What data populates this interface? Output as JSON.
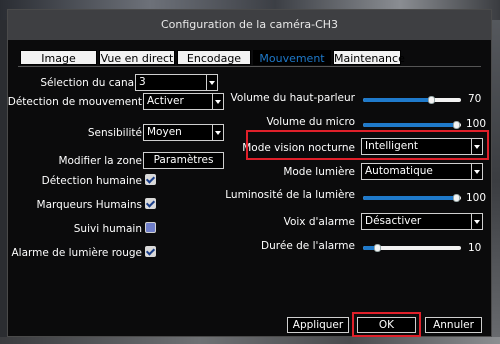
{
  "dialog": {
    "title": "Configuration de la caméra-CH3"
  },
  "tabs": [
    "Image",
    "Vue en direct",
    "Encodage",
    "Mouvement",
    "Maintenance"
  ],
  "active_tab": "Mouvement",
  "left": {
    "channel": {
      "label": "Sélection du canal",
      "value": "3"
    },
    "motion": {
      "label": "Détection de mouvement",
      "value": "Activer"
    },
    "sensitivity": {
      "label": "Sensibilité",
      "value": "Moyen"
    },
    "zone": {
      "label": "Modifier la zone",
      "button": "Paramètres"
    },
    "human_detection": {
      "label": "Détection humaine",
      "checked": true
    },
    "human_markers": {
      "label": "Marqueurs Humains",
      "checked": true
    },
    "human_tracking": {
      "label": "Suivi humain",
      "checked": false
    },
    "red_light": {
      "label": "Alarme de lumière rouge",
      "checked": true
    }
  },
  "right": {
    "speaker_volume": {
      "label": "Volume du haut-parleur",
      "value": "70",
      "fraction": 0.7
    },
    "mic_volume": {
      "label": "Volume du micro",
      "value": "100",
      "fraction": 1.0
    },
    "night_mode": {
      "label": "Mode vision nocturne",
      "value": "Intelligent"
    },
    "light_mode": {
      "label": "Mode lumière",
      "value": "Automatique"
    },
    "light_brightness": {
      "label": "Luminosité de la lumière",
      "value": "100",
      "fraction": 1.0
    },
    "alarm_voice": {
      "label": "Voix d'alarme",
      "value": "Désactiver"
    },
    "alarm_duration": {
      "label": "Durée de l'alarme",
      "value": "10",
      "fraction": 0.1
    }
  },
  "footer": {
    "apply": "Appliquer",
    "ok": "OK",
    "cancel": "Annuler"
  },
  "colors": {
    "accent": "#1f7acb",
    "highlight": "#e0202a",
    "active_tab_text": "#1e78c8"
  }
}
